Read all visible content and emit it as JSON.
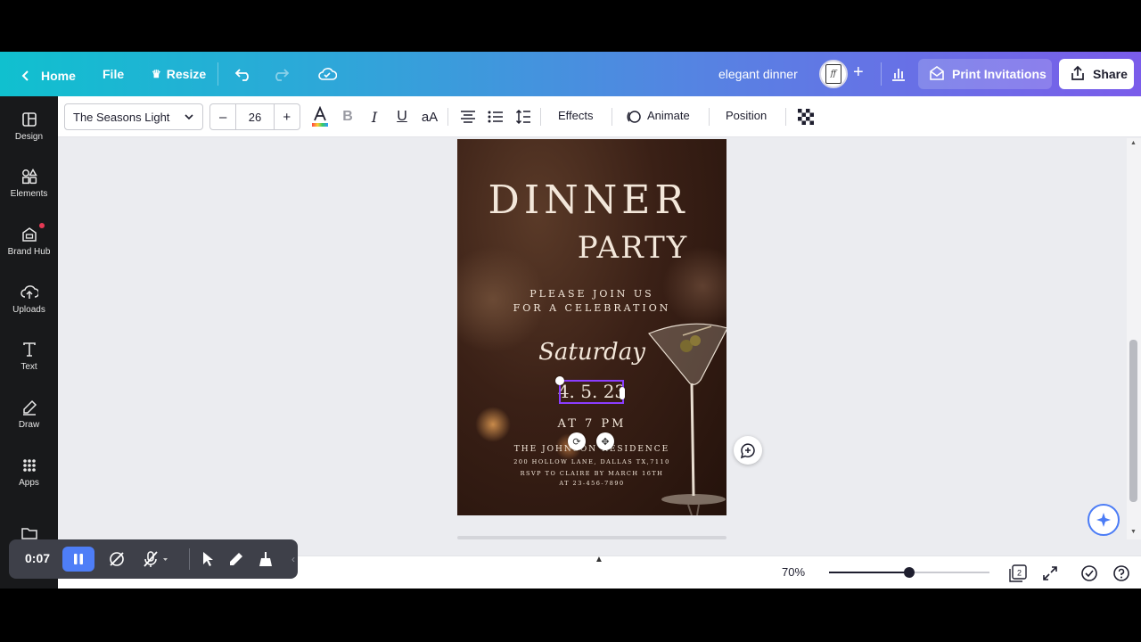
{
  "topbar": {
    "home": "Home",
    "file": "File",
    "resize": "Resize",
    "doc_title": "elegant dinner",
    "avatar_initials": "ff",
    "print": "Print Invitations",
    "share": "Share"
  },
  "sidebar": {
    "items": [
      {
        "label": "Design",
        "icon": "design-icon"
      },
      {
        "label": "Elements",
        "icon": "elements-icon"
      },
      {
        "label": "Brand Hub",
        "icon": "brand-hub-icon"
      },
      {
        "label": "Uploads",
        "icon": "uploads-icon"
      },
      {
        "label": "Text",
        "icon": "text-icon"
      },
      {
        "label": "Draw",
        "icon": "draw-icon"
      },
      {
        "label": "Apps",
        "icon": "apps-icon"
      }
    ]
  },
  "toolbar": {
    "font_name": "The Seasons Light",
    "font_size": "26",
    "minus": "–",
    "plus": "+",
    "effects": "Effects",
    "animate": "Animate",
    "position": "Position"
  },
  "invitation": {
    "title_line1": "DINNER",
    "title_line2": "PARTY",
    "join_line1": "PLEASE JOIN US",
    "join_line2": "FOR A CELEBRATION",
    "day": "Saturday",
    "date": "4. 5. 23",
    "time": "AT 7 PM",
    "venue": "THE JOHNSON RESIDENCE",
    "address": "200 HOLLOW LANE, DALLAS TX,7110",
    "rsvp": "RSVP TO CLAIRE BY MARCH 16TH",
    "phone": "AT 23-456-7890"
  },
  "bottombar": {
    "zoom": "70%",
    "zoom_level": 0.5,
    "page_count": "2"
  },
  "recorder": {
    "time": "0:07"
  },
  "colors": {
    "selection": "#8b3dff",
    "sidebar_bg": "#18191b",
    "accent_blue": "#4e7ef7"
  }
}
